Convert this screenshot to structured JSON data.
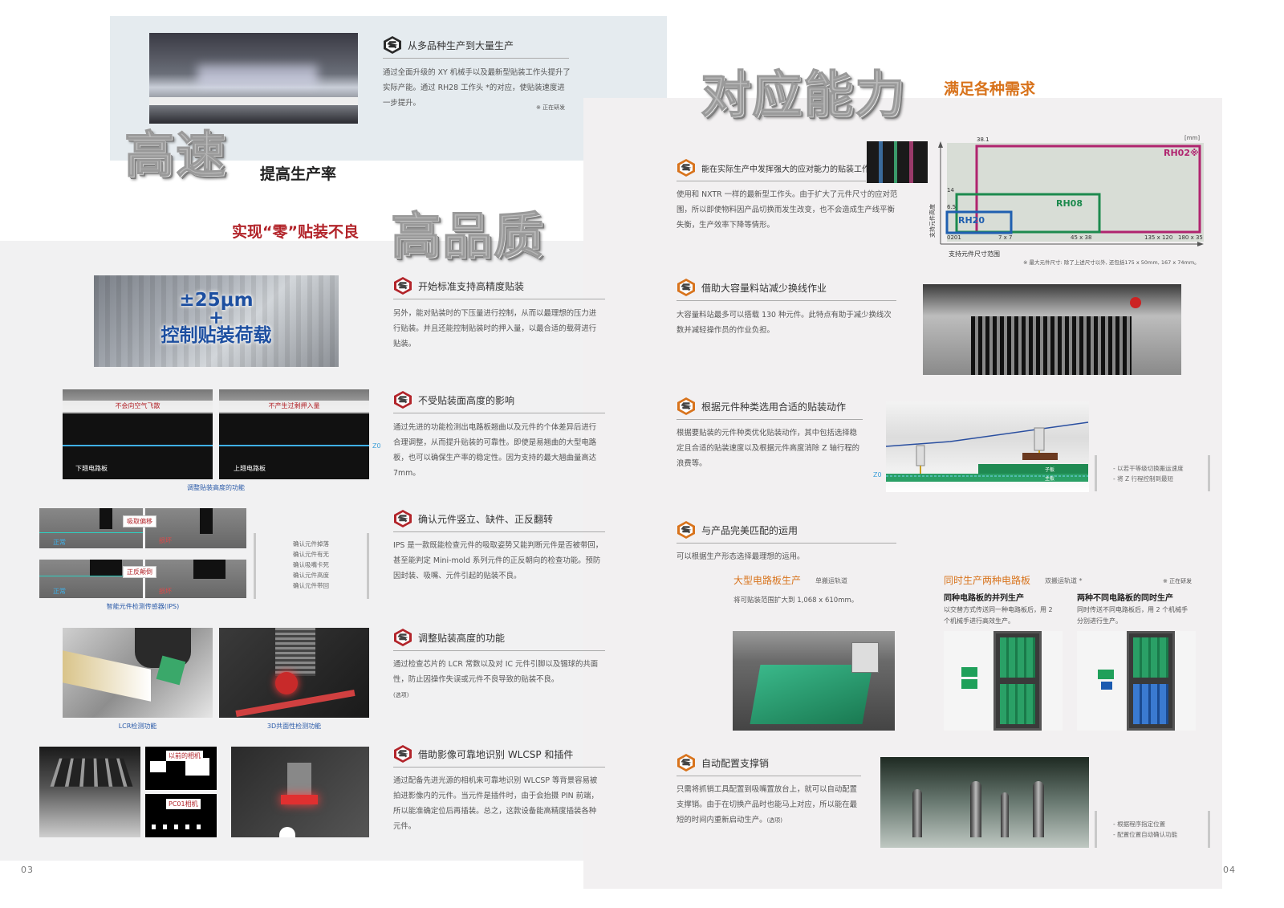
{
  "left": {
    "page_number": "03",
    "high_speed": {
      "title": "高速",
      "subtitle": "提高生产率",
      "section": {
        "heading": "从多品种生产到大量生产",
        "body": "通过全面升级的 XY 机械手以及最新型贴装工作头提升了实际产能。通过 RH28 工作头 *的对应，使贴装速度进一步提升。",
        "note": "※ 正在研发"
      }
    },
    "high_quality": {
      "tagline": "实现“零”贴装不良",
      "title": "高品质",
      "banner": {
        "line1": "±25μm",
        "line2": "+",
        "line3": "控制贴装荷载"
      },
      "sections": [
        {
          "heading": "开始标准支持高精度贴装",
          "body": "另外，能对贴装时的下压量进行控制，从而以最理想的压力进行贴装。并且还能控制贴装时的押入量，以最合适的载荷进行贴装。"
        },
        {
          "heading": "不受贴装面高度的影响",
          "body": "通过先进的功能检测出电路板翘曲以及元件的个体差异后进行合理调整，从而提升贴装的可靠性。即使是易翘曲的大型电路板，也可以确保生产率的稳定性。因为支持的最大翘曲量高达 7mm。"
        },
        {
          "heading": "确认元件竖立、缺件、正反翻转",
          "body": "IPS 是一款既能检查元件的吸取姿势又能判断元件是否被带回，甚至能判定 Mini-mold 系列元件的正反朝向的检查功能。预防因封装、吸嘴、元件引起的贴装不良。"
        },
        {
          "heading": "调整贴装高度的功能",
          "body": "通过检查芯片的 LCR 常数以及对 IC 元件引脚以及锡球的共面性，防止因操作失误或元件不良导致的贴装不良。",
          "sub": "(选项)"
        },
        {
          "heading": "借助影像可靠地识别 WLCSP 和插件",
          "body": "通过配备先进光源的相机来可靠地识别 WLCSP 等背景容易被拍进影像内的元件。当元件是插件时，由于会抬摄 PIN 前端，所以能准确定位后再插装。总之，这款设备能高精度插装各种元件。"
        }
      ],
      "height_figure": {
        "label_left_top": "不会向空气飞散",
        "label_right_top": "不产生过剩押入量",
        "label_left_bottom": "下翘电路板",
        "label_right_bottom": "上翘电路板",
        "z_label": "Z0",
        "caption": "调整贴装高度的功能"
      },
      "ips_figure": {
        "label_a": "吸取偏移",
        "label_b": "正反颠倒",
        "normal": "正常",
        "damaged": "损坏",
        "normal2": "正常",
        "damaged2": "损坏",
        "caption": "智能元件检测传感器(IPS)",
        "checklist": [
          "确认元件掉落",
          "确认元件有无",
          "确认吸嘴卡死",
          "确认元件高度",
          "确认元件带回"
        ]
      },
      "lcr_caption": "LCR检测功能",
      "coplanarity_caption": "3D共面性检测功能",
      "camera_labels": {
        "old": "以前的相机",
        "new": "PC01相机"
      }
    }
  },
  "right": {
    "page_number": "04",
    "title": "对应能力",
    "subtitle": "满足各种需求",
    "sections": [
      {
        "heading": "能在实际生产中发挥强大的应对能力的贴装工作头",
        "body": "使用和 NXTR 一样的最新型工作头。由于扩大了元件尺寸的应对范围，所以即使物料因产品切换而发生改变，也不会造成生产线平衡失衡，生产效率下降等情形。"
      },
      {
        "heading": "借助大容量料站减少换线作业",
        "body": "大容量料站最多可以搭载 130 种元件。此特点有助于减少换线次数并减轻操作员的作业负担。"
      },
      {
        "heading": "根据元件种类选用合适的贴装动作",
        "body": "根据要贴装的元件种类优化贴装动作，其中包括选择稳定且合适的贴装速度以及根据元件高度消除 Z 轴行程的浪费等。"
      },
      {
        "heading": "与产品完美匹配的运用",
        "body": "可以根据生产形态选择最理想的运用。"
      },
      {
        "heading": "自动配置支撑销",
        "body": "只需将抓销工具配置到吸嘴置放台上，就可以自动配置支撑销。由于在切换产品时也能马上对应，所以能在最短的时间内重新启动生产。",
        "sub": "(选项)"
      }
    ],
    "head_chart": {
      "unit": "[mm]",
      "ylabel": "支持元件高度",
      "xlabel": "支持元件尺寸范围",
      "footnote": "※ 最大元件尺寸: 除了上述尺寸以外, 还包括175 x 50mm, 167 x 74mm。",
      "y_ticks": [
        "38.1",
        "14",
        "6.5"
      ],
      "x_ticks": [
        "0201",
        "7 x 7",
        "45 x 38",
        "135 x 120",
        "180 x 35"
      ],
      "heads": [
        {
          "name": "RH20",
          "color": "#1f5fb0"
        },
        {
          "name": "RH08",
          "color": "#1d8a4e"
        },
        {
          "name": "RH02",
          "color": "#b0246f",
          "mark": "※"
        }
      ]
    },
    "zaxis_figure": {
      "z_label": "Z0",
      "child_board": "子板",
      "main_board": "主板",
      "bullets": [
        "以若干等级切换搬运速度",
        "将 Z 行程控制到最短"
      ]
    },
    "operation": {
      "large_board": {
        "title": "大型电路板生产",
        "tag": "单搬运轨道",
        "desc": "将可贴装范围扩大到 1,068 x 610mm。"
      },
      "dual": {
        "title": "同时生产两种电路板",
        "tag": "双搬运轨道 *",
        "note": "※ 正在研发",
        "parallel_title": "同种电路板的并列生产",
        "parallel_desc": "以交替方式传送同一种电路板后，用 2 个机械手进行高效生产。",
        "different_title": "两种不同电路板的同时生产",
        "different_desc": "同时传送不同电路板后，用 2 个机械手分别进行生产。"
      }
    },
    "pin_bullets": [
      "根据程序指定位置",
      "配置位置自动确认功能"
    ]
  },
  "colors": {
    "title_red": "#b2242a",
    "title_orange": "#d8731c",
    "accent_blue": "#2a5aa8"
  }
}
